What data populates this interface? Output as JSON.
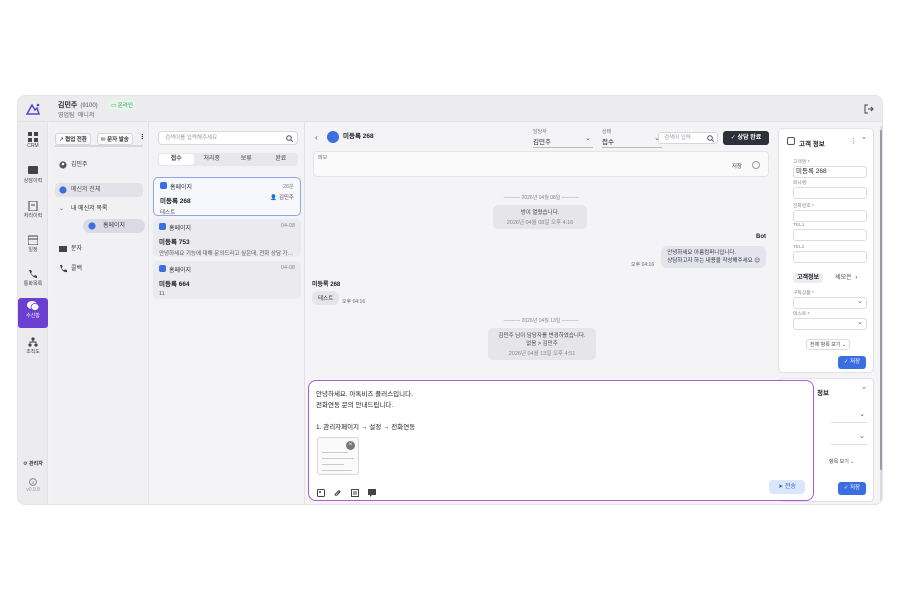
{
  "header": {
    "user_name": "김민주",
    "user_ext": "(9100)",
    "status": "온라인",
    "dept": "영업팀",
    "role": "매니저"
  },
  "rail": {
    "items": [
      {
        "label": "CRM"
      },
      {
        "label": "상담이력"
      },
      {
        "label": "처리이력"
      },
      {
        "label": "일정"
      },
      {
        "label": "통화목록"
      },
      {
        "label": "수신함"
      },
      {
        "label": "조직도"
      }
    ],
    "admin_label": "관리자",
    "version": "v0.9.8"
  },
  "sidebar": {
    "btn_start_chat": "협업 전환",
    "btn_send_sms": "문자 발송",
    "me": "김민주",
    "messenger_all": "메신저 전체",
    "my_messenger": "내 메신저 목록",
    "homepage": "홈페이지",
    "sms": "문자",
    "callback": "콜백"
  },
  "convlist": {
    "search_placeholder": "검색어를 입력해주세요",
    "tabs": [
      "접수",
      "처리중",
      "보류",
      "완료"
    ],
    "cards": [
      {
        "channel": "홈페이지",
        "time": "28분",
        "name": "미등록 268",
        "agent": "김민주",
        "msg": "테스트"
      },
      {
        "channel": "홈페이지",
        "time": "04-08",
        "name": "미등록 753",
        "msg": "안녕하세요 기능에 대해 문의드리고 싶은데, 전화 상담 가능할까요?"
      },
      {
        "channel": "홈페이지",
        "time": "04-08",
        "name": "미등록 664",
        "msg": "11"
      }
    ]
  },
  "chat": {
    "title": "미등록 268",
    "assignee_label": "담당자",
    "assignee": "김민주",
    "state_label": "상태",
    "state": "접수",
    "search_placeholder": "검색어 입력",
    "done_btn": "상담 완료",
    "memo_label": "메모",
    "memo_save": "저장",
    "date1": "---------- 2026년 04월 08일 ----------",
    "sys1": "방이 열렸습니다.",
    "sys1_time": "2026년 04월 08일 오후 4:16",
    "bot_label": "Bot",
    "bot_msg1": "안녕하세요 아름컴퍼니입니다.",
    "bot_msg2": "상담하고자 하는 내용을 작성해주세요 😉",
    "bot_time": "오후 04:16",
    "customer_label": "미등록 268",
    "cust_msg": "테스트",
    "cust_time": "오후 04:16",
    "date2": "---------- 2026년 04월 13일 ----------",
    "sys2_a": "김민주 님이 담당자를 변경하였습니다.",
    "sys2_b": "없음 > 김민주",
    "sys2_time": "2026년 04월 13일 오후 4:51"
  },
  "composer": {
    "line1": "안녕하세요. 아톡비즈 플러스입니다.",
    "line2": "전화연동 문의 안내드립니다.",
    "line3": "1. 관리자페이지 → 설정 → 전화연동",
    "send": "전송"
  },
  "customer_panel": {
    "title": "고객 정보",
    "name_label": "고객명",
    "name_value": "미등록 268",
    "company_label": "회사명",
    "phone_label": "전화번호",
    "tel1_label": "TEL1",
    "tel2_label": "TEL2",
    "tab_active": "고객정보",
    "tab_other": "세모은",
    "product_label": "구독상품",
    "test_label": "테스트",
    "more": "전체 항목 보기",
    "save": "저장"
  },
  "consult_panel": {
    "title": "정보",
    "more": "항목 보기",
    "save": "저장"
  },
  "colors": {
    "accent": "#6a3fd2",
    "primary": "#3b6fe0",
    "composer_border": "#a75be0"
  }
}
